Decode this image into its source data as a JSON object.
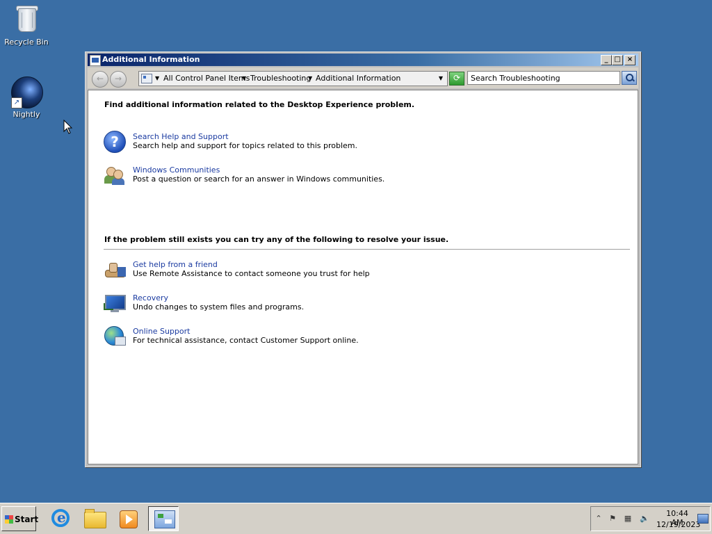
{
  "desktop": {
    "icons": [
      {
        "label": "Recycle Bin",
        "icon": "recycle-bin-icon"
      },
      {
        "label": "Nightly",
        "icon": "nightly-globe-icon"
      }
    ]
  },
  "window": {
    "title": "Additional Information",
    "controls": {
      "minimize": "_",
      "maximize": "□",
      "close": "×"
    },
    "nav": {
      "back": "←",
      "forward": "→",
      "breadcrumbs": [
        "All Control Panel Items",
        "Troubleshooting",
        "Additional Information"
      ],
      "search_placeholder": "Search Troubleshooting"
    },
    "content": {
      "heading1": "Find additional information related to the Desktop Experience problem.",
      "section1": [
        {
          "title": "Search Help and Support",
          "desc": "Search help and support for topics related to this problem.",
          "icon": "help-question-icon"
        },
        {
          "title": "Windows Communities",
          "desc": "Post a question or search for an answer in Windows communities.",
          "icon": "people-icon"
        }
      ],
      "heading2": "If the problem still exists you can try any of the following to resolve your issue.",
      "section2": [
        {
          "title": "Get help from a friend",
          "desc": "Use Remote Assistance to contact someone you trust for help",
          "icon": "helping-hand-icon"
        },
        {
          "title": "Recovery",
          "desc": "Undo changes to system files and programs.",
          "icon": "recovery-monitor-icon"
        },
        {
          "title": "Online Support",
          "desc": "For technical assistance, contact Customer Support online.",
          "icon": "online-globe-icon"
        }
      ]
    }
  },
  "taskbar": {
    "start_label": "Start",
    "apps": [
      "internet-explorer-icon",
      "file-explorer-icon",
      "media-player-icon",
      "control-panel-icon"
    ],
    "clock": {
      "time": "10:44 AM",
      "date": "12/19/2023"
    }
  },
  "colors": {
    "desktop": "#3a6ea5",
    "link": "#1a3aa0",
    "titlebar_start": "#0a246a",
    "titlebar_end": "#a6caf0"
  }
}
